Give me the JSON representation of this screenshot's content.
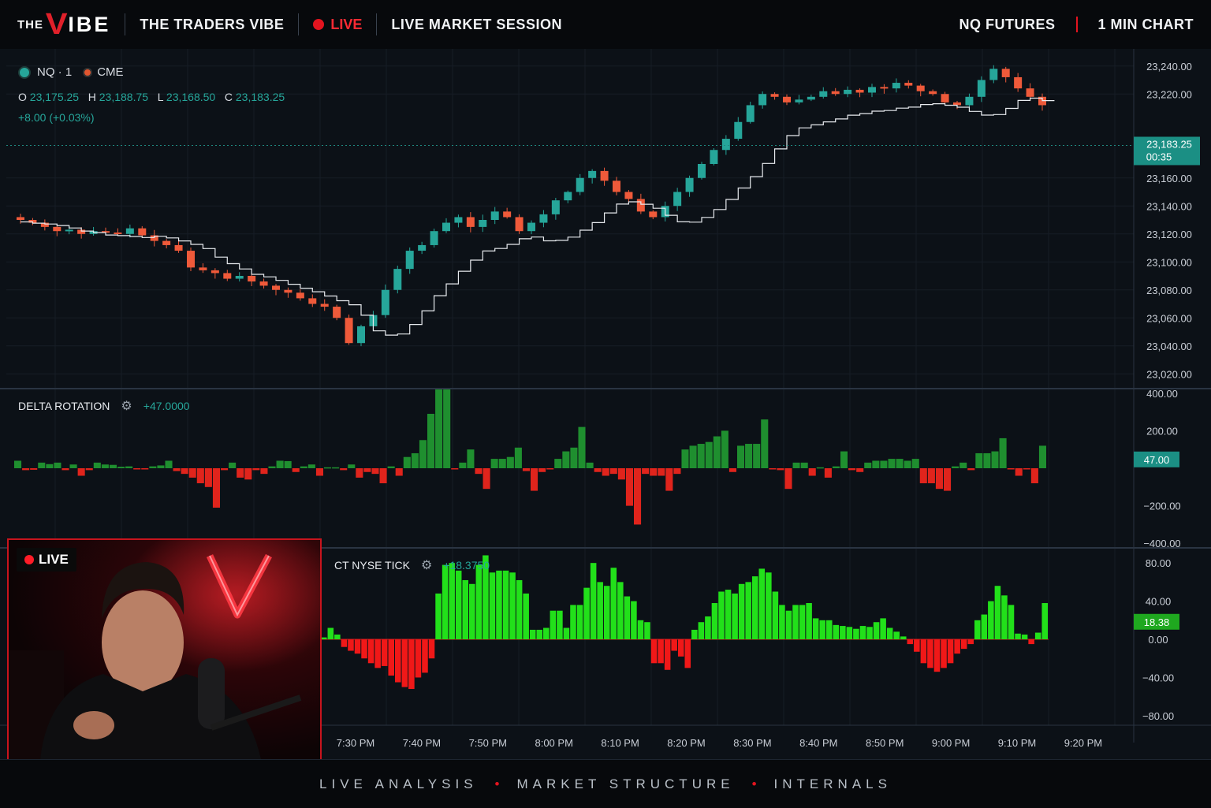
{
  "topbar": {
    "logo_the": "THE",
    "logo_v": "V",
    "logo_ibe": "IBE",
    "brand": "THE TRADERS VIBE",
    "live": "LIVE",
    "session": "LIVE MARKET SESSION",
    "instrument": "NQ FUTURES",
    "timeframe": "1 MIN CHART"
  },
  "legend": {
    "symbol": "NQ · 1",
    "exchange": "CME",
    "o_label": "O",
    "open": "23,175.25",
    "h_label": "H",
    "high": "23,188.75",
    "l_label": "L",
    "low": "23,168.50",
    "c_label": "C",
    "close": "23,183.25",
    "change": "+8.00 (+0.03%)"
  },
  "price_tag": {
    "price": "23,183.25",
    "countdown": "00:35"
  },
  "delta_pane": {
    "title": "DELTA ROTATION",
    "value": "+47.0000",
    "tag": "47.00"
  },
  "tick_pane": {
    "title": "CT NYSE TICK",
    "value": "+18.3750",
    "tag": "18.38"
  },
  "webcam": {
    "live": "LIVE"
  },
  "footer": {
    "items": [
      "LIVE ANALYSIS",
      "MARKET STRUCTURE",
      "INTERNALS"
    ]
  },
  "colors": {
    "up": "#26a69a",
    "down": "#ef5a3a",
    "tick_up": "#22e01a",
    "tick_down": "#f01818",
    "delta_up": "#1f8f2f",
    "delta_down": "#e0241c",
    "live": "#e3141f"
  },
  "chart_data": [
    {
      "type": "candlestick",
      "title": "",
      "ylim": [
        23010,
        23250
      ],
      "y_ticks": [
        "23,240.00",
        "23,220.00",
        "23,160.00",
        "23,140.00",
        "23,120.00",
        "23,100.00",
        "23,080.00",
        "23,060.00",
        "23,040.00",
        "23,020.00"
      ],
      "y_tick_values": [
        23240,
        23220,
        23160,
        23140,
        23120,
        23100,
        23080,
        23060,
        23040,
        23020
      ],
      "x_ticks": [
        "7:30 PM",
        "7:40 PM",
        "7:50 PM",
        "8:00 PM",
        "8:10 PM",
        "8:20 PM",
        "8:30 PM",
        "8:40 PM",
        "8:50 PM",
        "9:00 PM",
        "9:10 PM",
        "9:20 PM"
      ],
      "close_path": [
        23130,
        23128,
        23125,
        23122,
        23123,
        23120,
        23122,
        23121,
        23120,
        23124,
        23119,
        23115,
        23112,
        23108,
        23096,
        23094,
        23092,
        23088,
        23090,
        23086,
        23083,
        23080,
        23078,
        23074,
        23070,
        23068,
        23060,
        23042,
        23054,
        23062,
        23080,
        23095,
        23108,
        23112,
        23122,
        23128,
        23132,
        23125,
        23130,
        23136,
        23132,
        23122,
        23128,
        23134,
        23144,
        23150,
        23160,
        23165,
        23158,
        23150,
        23145,
        23136,
        23132,
        23140,
        23150,
        23160,
        23170,
        23180,
        23188,
        23200,
        23212,
        23220,
        23218,
        23214,
        23216,
        23218,
        23222,
        23220,
        23223,
        23221,
        23225,
        23224,
        23228,
        23226,
        23222,
        23220,
        23214,
        23212,
        23218,
        23230,
        23238,
        23232,
        23224,
        23218,
        23212
      ],
      "vwap_range": [
        23053,
        23209
      ]
    },
    {
      "type": "bar",
      "title": "DELTA ROTATION",
      "ylim": [
        -420,
        420
      ],
      "y_ticks": [
        "400.00",
        "200.00",
        "−200.00",
        "−400.00"
      ],
      "y_tick_values": [
        400,
        200,
        -200,
        -400
      ],
      "values": [
        40,
        -10,
        -8,
        30,
        22,
        30,
        -10,
        20,
        -40,
        -10,
        30,
        20,
        18,
        8,
        10,
        -5,
        -5,
        10,
        15,
        40,
        -15,
        -30,
        -50,
        -80,
        -100,
        -210,
        -10,
        30,
        -50,
        -60,
        -10,
        -30,
        10,
        40,
        38,
        -20,
        10,
        20,
        -40,
        5,
        5,
        -10,
        20,
        -50,
        -20,
        -30,
        -80,
        10,
        -40,
        60,
        80,
        150,
        290,
        420,
        420,
        -5,
        30,
        100,
        -30,
        -110,
        50,
        50,
        60,
        110,
        -15,
        -120,
        -20,
        -5,
        50,
        90,
        110,
        220,
        30,
        -20,
        -40,
        -30,
        -60,
        -200,
        -300,
        -30,
        -40,
        -40,
        -120,
        -30,
        100,
        120,
        130,
        140,
        170,
        200,
        -20,
        120,
        130,
        130,
        260,
        -5,
        -10,
        -110,
        30,
        30,
        -40,
        5,
        -50,
        10,
        90,
        -10,
        -20,
        30,
        40,
        40,
        50,
        50,
        40,
        50,
        -80,
        -80,
        -110,
        -120,
        10,
        30,
        -10,
        80,
        80,
        90,
        160,
        -5,
        -40,
        -5,
        -80,
        120
      ]
    },
    {
      "type": "bar",
      "title": "CT NYSE TICK",
      "ylim": [
        -90,
        95
      ],
      "y_ticks": [
        "80.00",
        "40.00",
        "0.00",
        "−40.00",
        "−80.00"
      ],
      "y_tick_values": [
        80,
        40,
        0,
        -40,
        -80
      ],
      "values": [
        2,
        12,
        5,
        -8,
        -12,
        -15,
        -20,
        -25,
        -30,
        -28,
        -38,
        -45,
        -50,
        -52,
        -40,
        -35,
        -20,
        48,
        78,
        80,
        72,
        62,
        58,
        78,
        88,
        70,
        72,
        72,
        70,
        62,
        48,
        10,
        10,
        12,
        30,
        30,
        12,
        36,
        36,
        54,
        80,
        60,
        56,
        75,
        60,
        45,
        40,
        20,
        18,
        -25,
        -25,
        -32,
        -12,
        -18,
        -30,
        10,
        18,
        24,
        38,
        50,
        52,
        48,
        58,
        60,
        66,
        74,
        70,
        50,
        36,
        30,
        36,
        36,
        38,
        22,
        20,
        20,
        15,
        14,
        13,
        11,
        14,
        13,
        18,
        22,
        12,
        8,
        3,
        -5,
        -13,
        -25,
        -30,
        -34,
        -30,
        -25,
        -15,
        -10,
        -5,
        20,
        26,
        40,
        56,
        46,
        36,
        6,
        5,
        -5,
        7,
        38
      ]
    }
  ]
}
